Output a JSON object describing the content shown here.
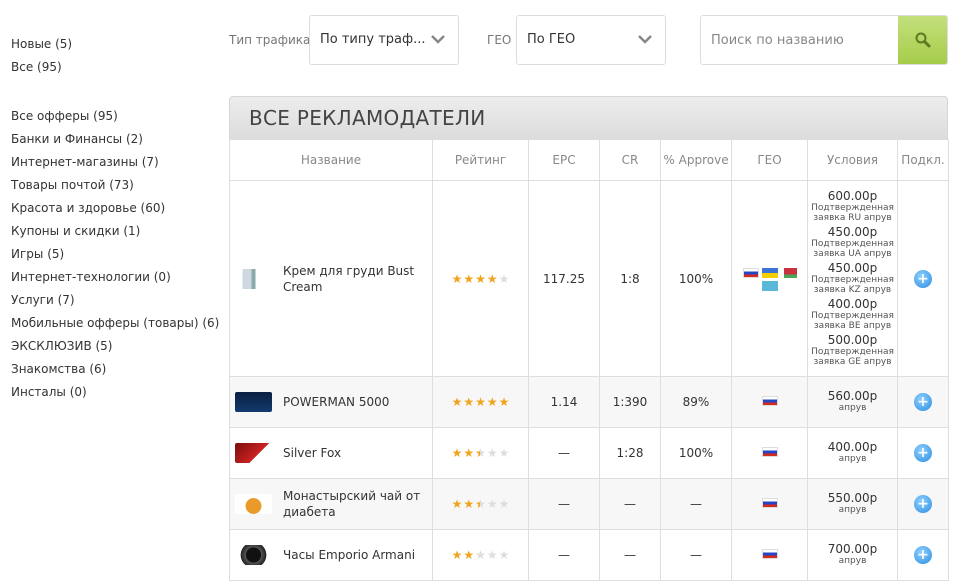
{
  "top_links": [
    "Новые (5)",
    "Все (95)"
  ],
  "categories": [
    "Все офферы (95)",
    "Банки и Финансы (2)",
    "Интернет-магазины (7)",
    "Товары почтой (73)",
    "Красота и здоровье (60)",
    "Купоны и скидки (1)",
    "Игры (5)",
    "Интернет-технологии (0)",
    "Услуги (7)",
    "Мобильные офферы (товары) (6)",
    "ЭКСКЛЮЗИВ (5)",
    "Знакомства (6)",
    "Инсталы (0)"
  ],
  "filters": {
    "traffic_label": "Тип трафика",
    "traffic_value": "По типу траф...",
    "geo_label": "ГЕО",
    "geo_value": "По ГЕО",
    "search_placeholder": "Поиск по названию"
  },
  "panel_title": "ВСЕ РЕКЛАМОДАТЕЛИ",
  "columns": [
    "Название",
    "Рейтинг",
    "EPC",
    "CR",
    "% Approve",
    "ГЕО",
    "Условия",
    "Подкл."
  ],
  "offers": [
    {
      "name": "Крем для груди Bust Cream",
      "rating": 4,
      "epc": "117.25",
      "cr": "1:8",
      "approve": "100%",
      "geo": [
        "ru",
        "ua",
        "by",
        "kz"
      ],
      "terms": [
        {
          "price": "600.00р",
          "note": "Подтвержденная заявка RU апрув"
        },
        {
          "price": "450.00р",
          "note": "Подтвержденная заявка UA апрув"
        },
        {
          "price": "450.00р",
          "note": "Подтвержденная заявка KZ апрув"
        },
        {
          "price": "400.00р",
          "note": "Подтвержденная заявка BE апрув"
        },
        {
          "price": "500.00р",
          "note": "Подтвержденная заявка GE апрув"
        }
      ]
    },
    {
      "name": "POWERMAN 5000",
      "rating": 5,
      "epc": "1.14",
      "cr": "1:390",
      "approve": "89%",
      "geo": [
        "ru"
      ],
      "terms": [
        {
          "price": "560.00р",
          "note": "апрув"
        }
      ]
    },
    {
      "name": "Silver Fox",
      "rating": 2.5,
      "epc": "—",
      "cr": "1:28",
      "approve": "100%",
      "geo": [
        "ru"
      ],
      "terms": [
        {
          "price": "400.00р",
          "note": "апрув"
        }
      ]
    },
    {
      "name": "Монастырский чай от диабета",
      "rating": 2.5,
      "epc": "—",
      "cr": "—",
      "approve": "—",
      "geo": [
        "ru"
      ],
      "terms": [
        {
          "price": "550.00р",
          "note": "апрув"
        }
      ]
    },
    {
      "name": "Часы Emporio Armani",
      "rating": 2,
      "epc": "—",
      "cr": "—",
      "approve": "—",
      "geo": [
        "ru"
      ],
      "terms": [
        {
          "price": "700.00р",
          "note": "апрув"
        }
      ]
    }
  ],
  "colors": {
    "accent_green": "#a6cc4a",
    "star": "#f1a31b",
    "plus_blue": "#2a8de0"
  }
}
